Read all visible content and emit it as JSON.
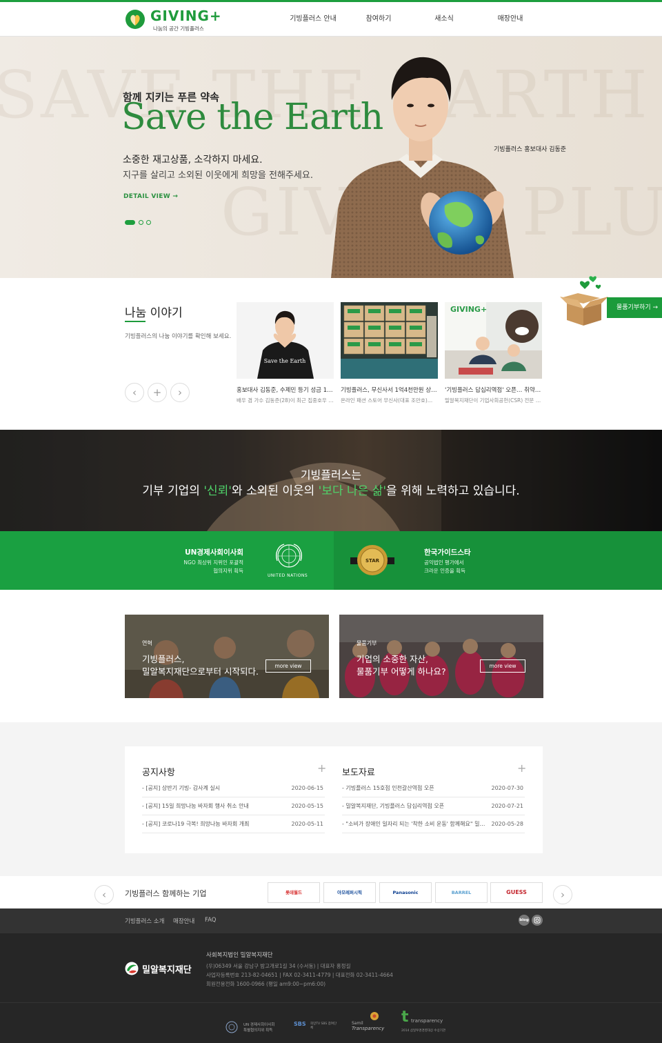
{
  "header": {
    "logo_word": "GIVING+",
    "logo_sub": "나눔의 공간 기빙플러스",
    "nav": [
      "기빙플러스 안내",
      "참여하기",
      "새소식",
      "매장안내"
    ]
  },
  "hero": {
    "bg_text_1": "SAVE THE EARTH",
    "bg_text_2": "GIVING PLUS",
    "kicker": "함께 지키는 푸른 약속",
    "title": "Save the Earth",
    "line1": "소중한 재고상품, 소각하지 마세요.",
    "line2": "지구를 살리고 소외된 이웃에게 희망을 전해주세요.",
    "detail": "DETAIL VIEW →",
    "ambassador": "기빙플러스 홍보대사 김동준",
    "active_slide": 1,
    "slide_count": 3
  },
  "stories": {
    "title": "나눔 이야기",
    "desc": "기빙플러스의 나눔 이야기를 확인해 보세요.",
    "prev": "‹",
    "add": "+",
    "next": "›",
    "cards": [
      {
        "title": "홍보대사 김동준, 수제민 등기 성금 1…",
        "desc": "배우 겸 가수 김동준(28)이 최근 집중호우 …"
      },
      {
        "title": "기빙플러스, 무신사서 1억4천만원 상…",
        "desc": "온라인 패션 스토어 무신사(대표 조만호)…"
      },
      {
        "title": "'기빙플러스 답십리역점' 오픈… 취약…",
        "desc": "밀알복지재단이 기업사회공헌(CSR) 전문 …"
      }
    ],
    "card1_shirt_text": "Save the Earth"
  },
  "donate": {
    "label": "물품기부하기 →"
  },
  "banner": {
    "line1": "기빙플러스는",
    "pre": "기부 기업의 ",
    "hl1": "'신뢰'",
    "mid": "와 소외된 이웃의 ",
    "hl2": "'보다 나은 삶'",
    "post": "을 위해 노력하고 있습니다."
  },
  "certs": {
    "left": {
      "title": "UN경제사회이사회",
      "l1": "NGO 최상위 지위인 포괄적",
      "l2": "협의지위 획득",
      "emblem": "UNITED NATIONS"
    },
    "right": {
      "title": "한국가이드스타",
      "l1": "공익법인 평가에서",
      "l2": "크라운 인증을 획득",
      "badge": "STAR"
    }
  },
  "promos": [
    {
      "tag": "연혁",
      "line1": "기빙플러스,",
      "line2": "밀알복지재단으로부터 시작되다.",
      "more": "more view"
    },
    {
      "tag": "물품기부",
      "line1": "기업의 소중한 자산,",
      "line2": "물품기부 어떻게 하나요?",
      "more": "more view"
    }
  ],
  "notice": {
    "title": "공지사항",
    "plus": "+",
    "items": [
      {
        "title": "- [공지] 상반기 기빙- 감사계 실시",
        "date": "2020-06-15"
      },
      {
        "title": "- [공지] 15일 희망나눔 바자회 행사 취소 안내",
        "date": "2020-05-15"
      },
      {
        "title": "- [공지] 코로나19 극복! 희망나눔 바자회 개최",
        "date": "2020-05-11"
      }
    ]
  },
  "press": {
    "title": "보도자료",
    "plus": "+",
    "items": [
      {
        "title": "- 기빙플러스 15호점 인천갈산역점 오픈",
        "date": "2020-07-30"
      },
      {
        "title": "- 밀알복지재단, 기빙플러스 답십리역점 오픈",
        "date": "2020-07-21"
      },
      {
        "title": "- \"소비가 장애인 일자리 되는 '착한 소비 운동' 함께해요\" 밀…",
        "date": "2020-05-28"
      }
    ]
  },
  "partners": {
    "title": "기빙플러스 함께하는 기업",
    "prev": "‹",
    "next": "›",
    "logos": [
      "롯데월드",
      "아모레퍼시픽",
      "Panasonic",
      "BARREL",
      "GUESS"
    ]
  },
  "footer": {
    "nav": [
      "기빙플러스 소개",
      "매장안내",
      "FAQ"
    ],
    "blog": "blog",
    "foundation": "밀알복지재단",
    "org": "사회복지법인 밀알복지재단",
    "addr": "(우)06349 서울 강남구 밤고개로1길 34 (수서동)  |  대표자 홍정길",
    "biz": "사업자등록번호 213-82-04651  |  FAX 02-3411-4779  |  대표전화 02-3411-4664",
    "tel": "회원전용전화 1600-0966 (평일 am9:00~pm6:00)",
    "badges": [
      {
        "l1": "UN 경제사회이사회",
        "l2": "특별협의지위 획득"
      },
      {
        "l1": "SBS",
        "l2": "희망TV SBS 참여단체"
      },
      {
        "l1": "Samil",
        "l2": "Transparency"
      },
      {
        "l1": "transparency",
        "l2": "2014 삼일투명경영대상 수상기관"
      }
    ]
  },
  "colors": {
    "brand_green": "#1e9e3e",
    "dark_banner": "#2c2b29",
    "footer": "#262626"
  }
}
